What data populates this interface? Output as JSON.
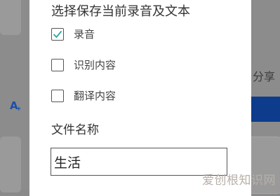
{
  "background": {
    "share_label": "分享",
    "translate_icon_letter": "A"
  },
  "dialog": {
    "title": "选择保存当前录音及文本",
    "options": [
      {
        "label": "录音",
        "checked": true
      },
      {
        "label": "识别内容",
        "checked": false
      },
      {
        "label": "翻译内容",
        "checked": false
      }
    ],
    "filename_label": "文件名称",
    "filename_value": "生活"
  },
  "watermark": {
    "text": "爱创根知识网"
  },
  "colors": {
    "checkmark": "#2ca5a5",
    "overlay": "#8c8c8c",
    "dialog": "#ffffff",
    "accent_blue": "#0d3c8c"
  }
}
